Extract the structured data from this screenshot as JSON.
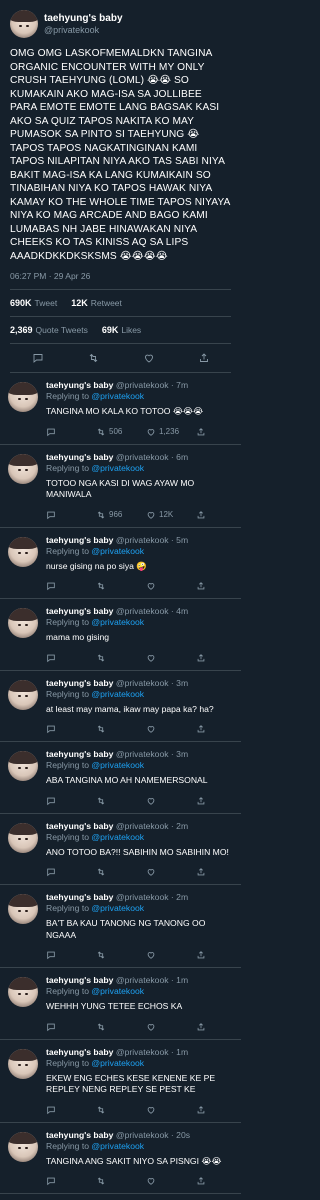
{
  "tweet": {
    "name": "taehyung's baby ",
    "handle": "@privatekook",
    "text": "OMG OMG LASKOFMEMALDKN TANGINA ORGANIC ENCOUNTER WITH MY ONLY CRUSH TAEHYUNG (LOML) 😭😭  SO KUMAKAIN AKO MAG-ISA SA JOLLIBEE PARA EMOTE EMOTE LANG BAGSAK KASI AKO SA QUIZ TAPOS NAKITA KO MAY PUMASOK SA PINTO SI TAEHYUNG 😭 TAPOS TAPOS NAGKATINGINAN KAMI TAPOS NILAPITAN NIYA AKO TAS SABI NIYA BAKIT MAG-ISA KA LANG KUMAIKAIN SO TINABIHAN NIYA KO TAPOS HAWAK NIYA KAMAY KO THE WHOLE TIME TAPOS NIYAYA NIYA KO MAG ARCADE AND BAGO KAMI LUMABAS NH JABE HINAWAKAN NIYA CHEEKS KO TAS KINISS AQ SA LIPS AAADKDKKDKSKSMS 😭😭😭😭",
    "time": "06:27 PM · 29 Apr 26",
    "stats": [
      {
        "value": "690K",
        "label": "Tweet"
      },
      {
        "value": "12K",
        "label": "Retweet"
      }
    ],
    "stats2": [
      {
        "value": "2,369",
        "label": "Quote Tweets"
      },
      {
        "value": "69K",
        "label": "Likes"
      }
    ]
  },
  "replies": [
    {
      "name": "taehyung's baby ",
      "handle": "@privatekook",
      "time": " · 7m",
      "to_label": "Replying to ",
      "to": "@privatekook",
      "text": "TANGINA MO KALA KO TOTOO 😭😭😭",
      "retweets": "506",
      "likes": "1,236"
    },
    {
      "name": "taehyung's baby ",
      "handle": "@privatekook",
      "time": " · 6m",
      "to_label": "Replying to ",
      "to": "@privatekook",
      "text": "TOTOO NGA KASI DI WAG AYAW MO MANIWALA",
      "retweets": "966",
      "likes": "12K"
    },
    {
      "name": "taehyung's baby ",
      "handle": "@privatekook",
      "time": " · 5m",
      "to_label": "Replying to ",
      "to": "@privatekook",
      "text": "nurse gising na po siya 🤪",
      "retweets": "",
      "likes": ""
    },
    {
      "name": "taehyung's baby ",
      "handle": "@privatekook",
      "time": " · 4m",
      "to_label": "Replying to ",
      "to": "@privatekook",
      "text": "mama mo gising",
      "retweets": "",
      "likes": ""
    },
    {
      "name": "taehyung's baby ",
      "handle": "@privatekook",
      "time": " · 3m",
      "to_label": "Replying to ",
      "to": "@privatekook",
      "text": "at least may mama, ikaw may papa ka? ha?",
      "retweets": "",
      "likes": ""
    },
    {
      "name": "taehyung's baby ",
      "handle": "@privatekook",
      "time": " · 3m",
      "to_label": "Replying to ",
      "to": "@privatekook",
      "text": "ABA TANGINA MO AH NAMEMERSONAL",
      "retweets": "",
      "likes": ""
    },
    {
      "name": "taehyung's baby ",
      "handle": "@privatekook",
      "time": " · 2m",
      "to_label": "Replying to ",
      "to": "@privatekook",
      "text": "ANO TOTOO BA?!! SABIHIN MO SABIHIN MO!",
      "retweets": "",
      "likes": ""
    },
    {
      "name": "taehyung's baby ",
      "handle": "@privatekook",
      "time": " · 2m",
      "to_label": "Replying to ",
      "to": "@privatekook",
      "text": "BA'T BA KAU TANONG NG TANONG OO NGAAA",
      "retweets": "",
      "likes": ""
    },
    {
      "name": "taehyung's baby ",
      "handle": "@privatekook",
      "time": " · 1m",
      "to_label": "Replying to ",
      "to": "@privatekook",
      "text": "WEHHH YUNG TETEE ECHOS KA",
      "retweets": "",
      "likes": ""
    },
    {
      "name": "taehyung's baby ",
      "handle": "@privatekook",
      "time": " · 1m",
      "to_label": "Replying to ",
      "to": "@privatekook",
      "text": "EKEW ENG ECHES KESE KENENE KE PE REPLEY NENG REPLEY SE PEST KE",
      "retweets": "",
      "likes": ""
    },
    {
      "name": "taehyung's baby ",
      "handle": "@privatekook",
      "time": " · 20s",
      "to_label": "Replying to ",
      "to": "@privatekook",
      "text": "TANGINA ANG SAKIT NIYO SA PISNGI 😭😭",
      "retweets": "",
      "likes": ""
    }
  ],
  "icons": {
    "reply": "comment-icon",
    "retweet": "retweet-icon",
    "like": "heart-icon",
    "share": "share-icon"
  },
  "colors": {
    "background": "#15202b",
    "divider": "#38444d",
    "muted": "#8899a6",
    "link": "#1da1f2"
  }
}
